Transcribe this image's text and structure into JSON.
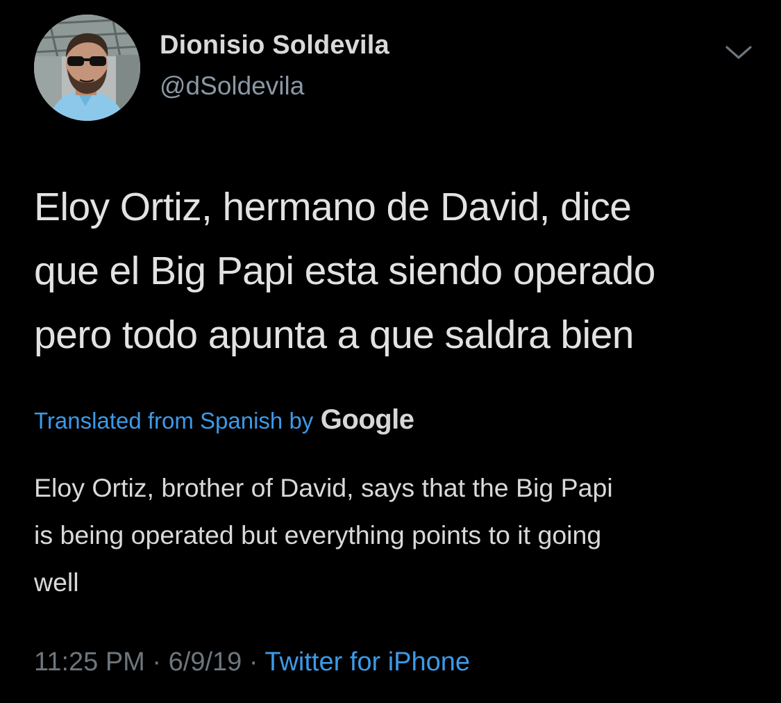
{
  "tweet": {
    "author": {
      "display_name": "Dionisio Soldevila",
      "handle": "@dSoldevila"
    },
    "text_lines": [
      "Eloy Ortiz, hermano de David, dice",
      "que el Big Papi esta siendo operado",
      "pero todo apunta a que saldra bien"
    ],
    "translation": {
      "label": "Translated from Spanish by",
      "provider": "Google",
      "lines": [
        "Eloy Ortiz, brother of David, says that the Big Papi",
        "is being operated but everything points to it going",
        "well"
      ]
    },
    "meta": {
      "time": "11:25 PM",
      "separator": "·",
      "date": "6/9/19",
      "source": "Twitter for iPhone"
    },
    "icons": {
      "more": "chevron-down-icon",
      "avatar": "profile-photo"
    },
    "colors": {
      "background": "#000000",
      "text": "#e2e2e2",
      "secondary": "#6e767d",
      "link": "#3d9ae8"
    }
  }
}
